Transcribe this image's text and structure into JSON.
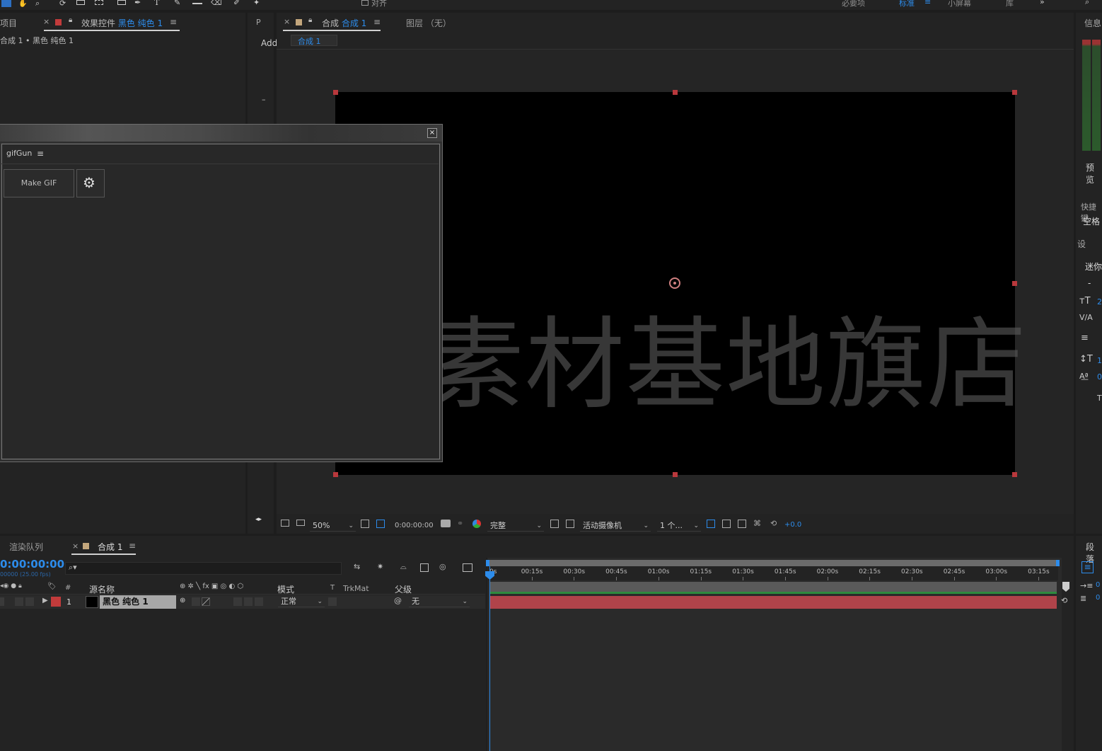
{
  "colors": {
    "accent": "#2d8ceb",
    "label_red": "#c23b3b",
    "comp_swatch": "#c3a67c",
    "layer_bar": "#b0434a",
    "handle": "#b9383c"
  },
  "toolbar": {
    "align_label": "对齐",
    "workspaces": [
      "必要项",
      "标准",
      "小屏幕",
      "库"
    ]
  },
  "project_panel": {
    "tab_title": "项目"
  },
  "effects_panel": {
    "tab_title": "效果控件",
    "layer_name": "黑色 纯色 1",
    "breadcrumb": "合成 1 • 黑色 纯色 1"
  },
  "mid_panel": {
    "tab_letter": "P",
    "add_label": "Add"
  },
  "comp_panel": {
    "tab_title": "合成",
    "comp_name": "合成 1",
    "layer_tab": "图层 （无）",
    "view_tab": "合成 1"
  },
  "gifgun": {
    "title": "gifGun",
    "make_gif": "Make GIF",
    "close": "×"
  },
  "viewer_bar": {
    "zoom": "50%",
    "timecode": "0:00:00:00",
    "resolution": "完整",
    "camera": "活动摄像机",
    "views": "1 个...",
    "exposure": "+0.0"
  },
  "right_panel": {
    "info": "信息",
    "preview": "预览",
    "shortcut": "快捷键",
    "space": "空格",
    "settings": "设",
    "mini": "迷你",
    "dash": "-",
    "paragraph": "段落",
    "font_size": "2",
    "tracking_value": "1",
    "baseline": "0",
    "indent1": "0",
    "indent2": "0"
  },
  "timeline": {
    "render_queue_tab": "渲染队列",
    "comp_tab": "合成 1",
    "timecode": "0:00:00:00",
    "fps": "00000 (25.00 fps)",
    "search_placeholder": "",
    "columns": {
      "number": "#",
      "source": "源名称",
      "mode": "模式",
      "t": "T",
      "trkmat": "TrkMat",
      "parent": "父级"
    },
    "ruler": [
      "0s",
      "00:15s",
      "00:30s",
      "00:45s",
      "01:00s",
      "01:15s",
      "01:30s",
      "01:45s",
      "02:00s",
      "02:15s",
      "02:30s",
      "02:45s",
      "03:00s",
      "03:15s"
    ],
    "layers": [
      {
        "index": "1",
        "name": "黑色 纯色 1",
        "mode": "正常",
        "parent": "无"
      }
    ]
  },
  "watermark": "落叶影视素材基地旗店"
}
